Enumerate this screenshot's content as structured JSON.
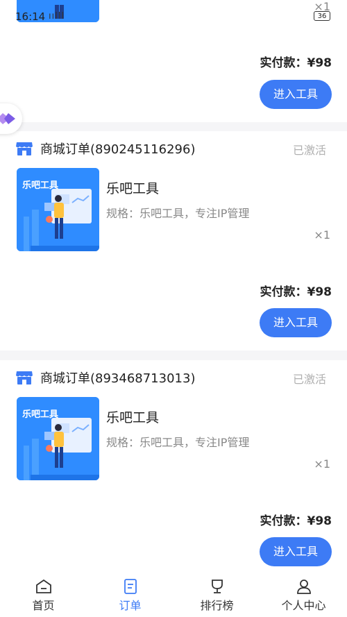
{
  "status_bar": {
    "time": "16:14",
    "signal": "ıılll",
    "battery": "36"
  },
  "top_card": {
    "qty": "×1",
    "paid_label": "实付款：",
    "paid_amount": "¥98",
    "button": "进入工具"
  },
  "orders": [
    {
      "title": "商城订单(890245116296)",
      "status": "已激活",
      "thumb_text": "乐吧工具",
      "product": "乐吧工具",
      "spec": "规格：乐吧工具，专注IP管理",
      "qty": "×1",
      "paid_label": "实付款：",
      "paid_amount": "¥98",
      "button": "进入工具"
    },
    {
      "title": "商城订单(893468713013)",
      "status": "已激活",
      "thumb_text": "乐吧工具",
      "product": "乐吧工具",
      "spec": "规格：乐吧工具，专注IP管理",
      "qty": "×1",
      "paid_label": "实付款：",
      "paid_amount": "¥98",
      "button": "进入工具"
    }
  ],
  "tabbar": [
    {
      "label": "首页",
      "icon": "home-icon"
    },
    {
      "label": "订单",
      "icon": "order-icon"
    },
    {
      "label": "排行榜",
      "icon": "trophy-icon"
    },
    {
      "label": "个人中心",
      "icon": "user-icon"
    }
  ],
  "colors": {
    "accent": "#3d7bf5",
    "status_gray": "#b0b0b0",
    "background": "#f5f5f7"
  }
}
